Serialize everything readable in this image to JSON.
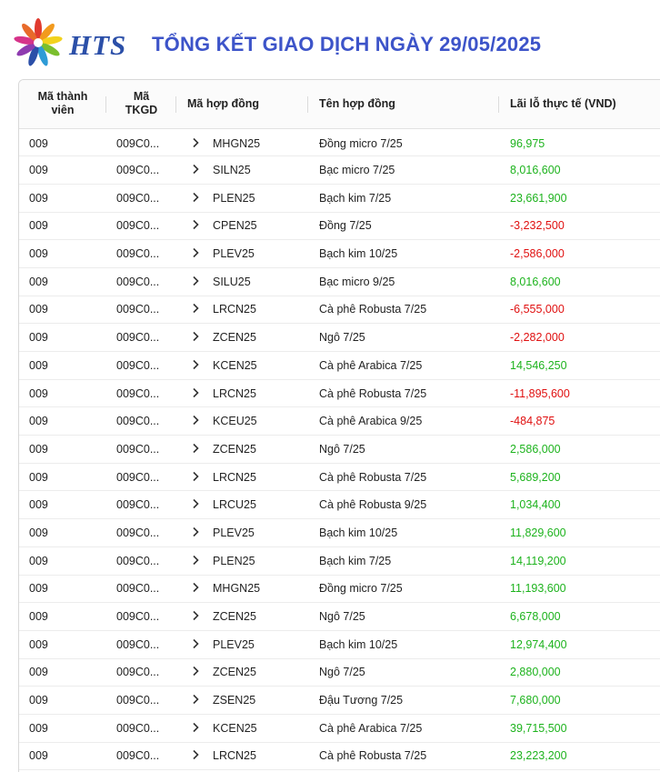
{
  "brand": {
    "logo_text": "HTS",
    "title": "TỔNG KẾT GIAO DỊCH NGÀY 29/05/2025"
  },
  "colors": {
    "positive": "#1db31d",
    "negative": "#e01010",
    "title": "#3d54c9",
    "brand": "#2b4fa8"
  },
  "table": {
    "headers": {
      "member_code_l1": "Mã thành",
      "member_code_l2": "viên",
      "account_l1": "Mã",
      "account_l2": "TKGD",
      "contract_code": "Mã hợp đồng",
      "contract_name": "Tên hợp đồng",
      "pnl": "Lãi lỗ thực tế (VND)"
    },
    "rows": [
      {
        "member": "009",
        "account": "009C0...",
        "code": "MHGN25",
        "name": "Đồng micro 7/25",
        "pnl": "96,975",
        "sign": "pos"
      },
      {
        "member": "009",
        "account": "009C0...",
        "code": "SILN25",
        "name": "Bạc micro 7/25",
        "pnl": "8,016,600",
        "sign": "pos"
      },
      {
        "member": "009",
        "account": "009C0...",
        "code": "PLEN25",
        "name": "Bạch kim 7/25",
        "pnl": "23,661,900",
        "sign": "pos"
      },
      {
        "member": "009",
        "account": "009C0...",
        "code": "CPEN25",
        "name": "Đồng 7/25",
        "pnl": "-3,232,500",
        "sign": "neg"
      },
      {
        "member": "009",
        "account": "009C0...",
        "code": "PLEV25",
        "name": "Bạch kim 10/25",
        "pnl": "-2,586,000",
        "sign": "neg"
      },
      {
        "member": "009",
        "account": "009C0...",
        "code": "SILU25",
        "name": "Bạc micro 9/25",
        "pnl": "8,016,600",
        "sign": "pos"
      },
      {
        "member": "009",
        "account": "009C0...",
        "code": "LRCN25",
        "name": "Cà phê Robusta 7/25",
        "pnl": "-6,555,000",
        "sign": "neg"
      },
      {
        "member": "009",
        "account": "009C0...",
        "code": "ZCEN25",
        "name": "Ngô 7/25",
        "pnl": "-2,282,000",
        "sign": "neg"
      },
      {
        "member": "009",
        "account": "009C0...",
        "code": "KCEN25",
        "name": "Cà phê Arabica 7/25",
        "pnl": "14,546,250",
        "sign": "pos"
      },
      {
        "member": "009",
        "account": "009C0...",
        "code": "LRCN25",
        "name": "Cà phê Robusta 7/25",
        "pnl": "-11,895,600",
        "sign": "neg"
      },
      {
        "member": "009",
        "account": "009C0...",
        "code": "KCEU25",
        "name": "Cà phê Arabica 9/25",
        "pnl": "-484,875",
        "sign": "neg"
      },
      {
        "member": "009",
        "account": "009C0...",
        "code": "ZCEN25",
        "name": "Ngô 7/25",
        "pnl": "2,586,000",
        "sign": "pos"
      },
      {
        "member": "009",
        "account": "009C0...",
        "code": "LRCN25",
        "name": "Cà phê Robusta 7/25",
        "pnl": "5,689,200",
        "sign": "pos"
      },
      {
        "member": "009",
        "account": "009C0...",
        "code": "LRCU25",
        "name": "Cà phê Robusta 9/25",
        "pnl": "1,034,400",
        "sign": "pos"
      },
      {
        "member": "009",
        "account": "009C0...",
        "code": "PLEV25",
        "name": "Bạch kim 10/25",
        "pnl": "11,829,600",
        "sign": "pos"
      },
      {
        "member": "009",
        "account": "009C0...",
        "code": "PLEN25",
        "name": "Bạch kim 7/25",
        "pnl": "14,119,200",
        "sign": "pos"
      },
      {
        "member": "009",
        "account": "009C0...",
        "code": "MHGN25",
        "name": "Đồng micro 7/25",
        "pnl": "11,193,600",
        "sign": "pos"
      },
      {
        "member": "009",
        "account": "009C0...",
        "code": "ZCEN25",
        "name": "Ngô 7/25",
        "pnl": "6,678,000",
        "sign": "pos"
      },
      {
        "member": "009",
        "account": "009C0...",
        "code": "PLEV25",
        "name": "Bạch kim 10/25",
        "pnl": "12,974,400",
        "sign": "pos"
      },
      {
        "member": "009",
        "account": "009C0...",
        "code": "ZCEN25",
        "name": "Ngô 7/25",
        "pnl": "2,880,000",
        "sign": "pos"
      },
      {
        "member": "009",
        "account": "009C0...",
        "code": "ZSEN25",
        "name": "Đậu Tương 7/25",
        "pnl": "7,680,000",
        "sign": "pos"
      },
      {
        "member": "009",
        "account": "009C0...",
        "code": "KCEN25",
        "name": "Cà phê Arabica 7/25",
        "pnl": "39,715,500",
        "sign": "pos"
      },
      {
        "member": "009",
        "account": "009C0...",
        "code": "LRCN25",
        "name": "Cà phê Robusta 7/25",
        "pnl": "23,223,200",
        "sign": "pos"
      }
    ]
  }
}
